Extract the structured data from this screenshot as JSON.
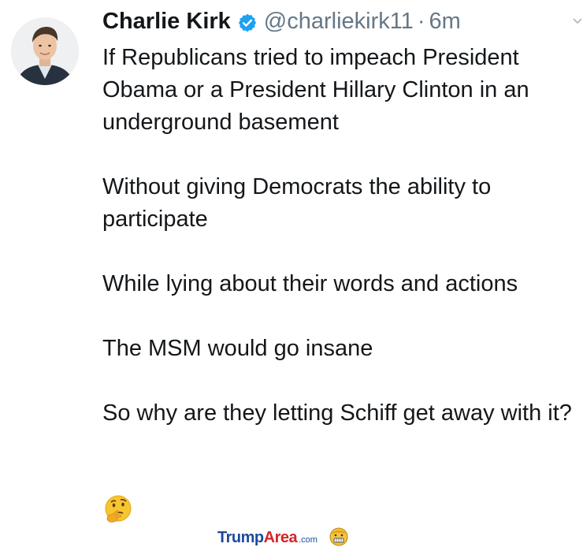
{
  "tweet": {
    "author_name": "Charlie Kirk",
    "handle": "@charliekirk11",
    "separator": "·",
    "time": "6m",
    "verified_icon": "verified-badge-icon",
    "avatar_icon": "avatar",
    "paragraphs": [
      "If Republicans tried to impeach President Obama or a President Hillary Clinton in an underground basement",
      "Without giving Democrats the ability to participate",
      "While lying about their words and actions",
      "The MSM would go insane",
      "So why are they letting Schiff get away with it?"
    ],
    "emoji": "thinking-face-emoji"
  },
  "watermark": {
    "part1": "Trump",
    "part2": "Area",
    "part3": ".com",
    "icon": "mascot-face-icon"
  },
  "colors": {
    "text": "#14171a",
    "muted": "#657786",
    "verified_blue": "#1da1f2",
    "watermark_blue": "#1d4b9b",
    "watermark_red": "#d4242a"
  }
}
